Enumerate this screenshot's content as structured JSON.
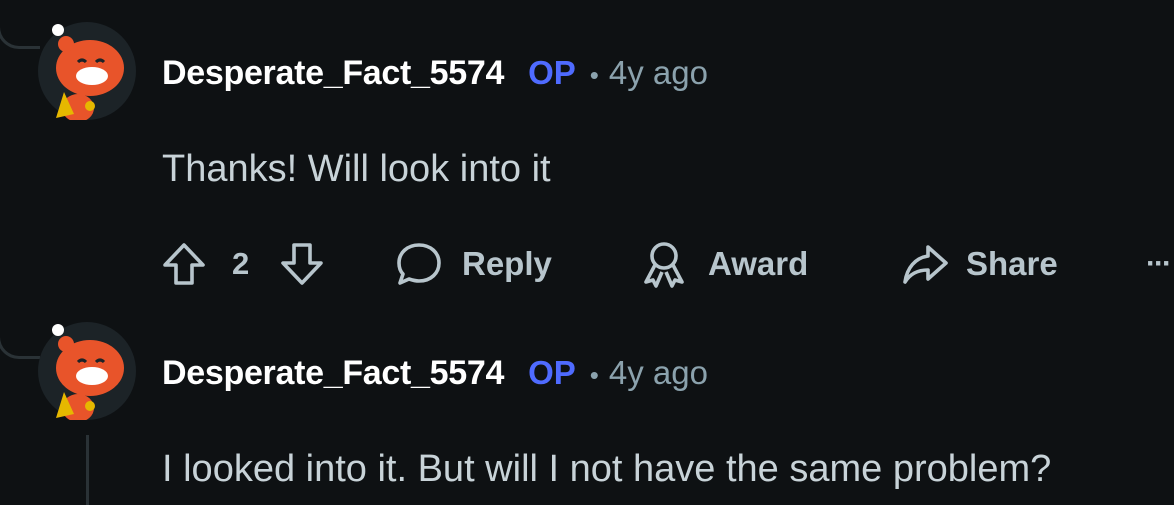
{
  "comments": [
    {
      "username": "Desperate_Fact_5574",
      "badge": "OP",
      "separator": "•",
      "timestamp": "4y ago",
      "body": "Thanks! Will look into it",
      "actions": {
        "vote_count": "2",
        "reply_label": "Reply",
        "award_label": "Award",
        "share_label": "Share",
        "more_label": "···"
      }
    },
    {
      "username": "Desperate_Fact_5574",
      "badge": "OP",
      "separator": "•",
      "timestamp": "4y ago",
      "body": "I looked into it. But will I not have the same problem?"
    }
  ],
  "colors": {
    "background": "#0e1113",
    "username": "#ffffff",
    "op_badge": "#4f6bff",
    "meta": "#8ba2ad",
    "body_text": "#c8d3d8",
    "action_text": "#b7c5cc",
    "thread_line": "#2a3236",
    "avatar_orange": "#e8542a"
  },
  "icons": {
    "avatar": "snoo-avatar-icon",
    "upvote": "arrow-up-icon",
    "downvote": "arrow-down-icon",
    "reply": "speech-bubble-icon",
    "award": "award-ribbon-icon",
    "share": "share-arrow-icon",
    "more": "ellipsis-icon"
  }
}
